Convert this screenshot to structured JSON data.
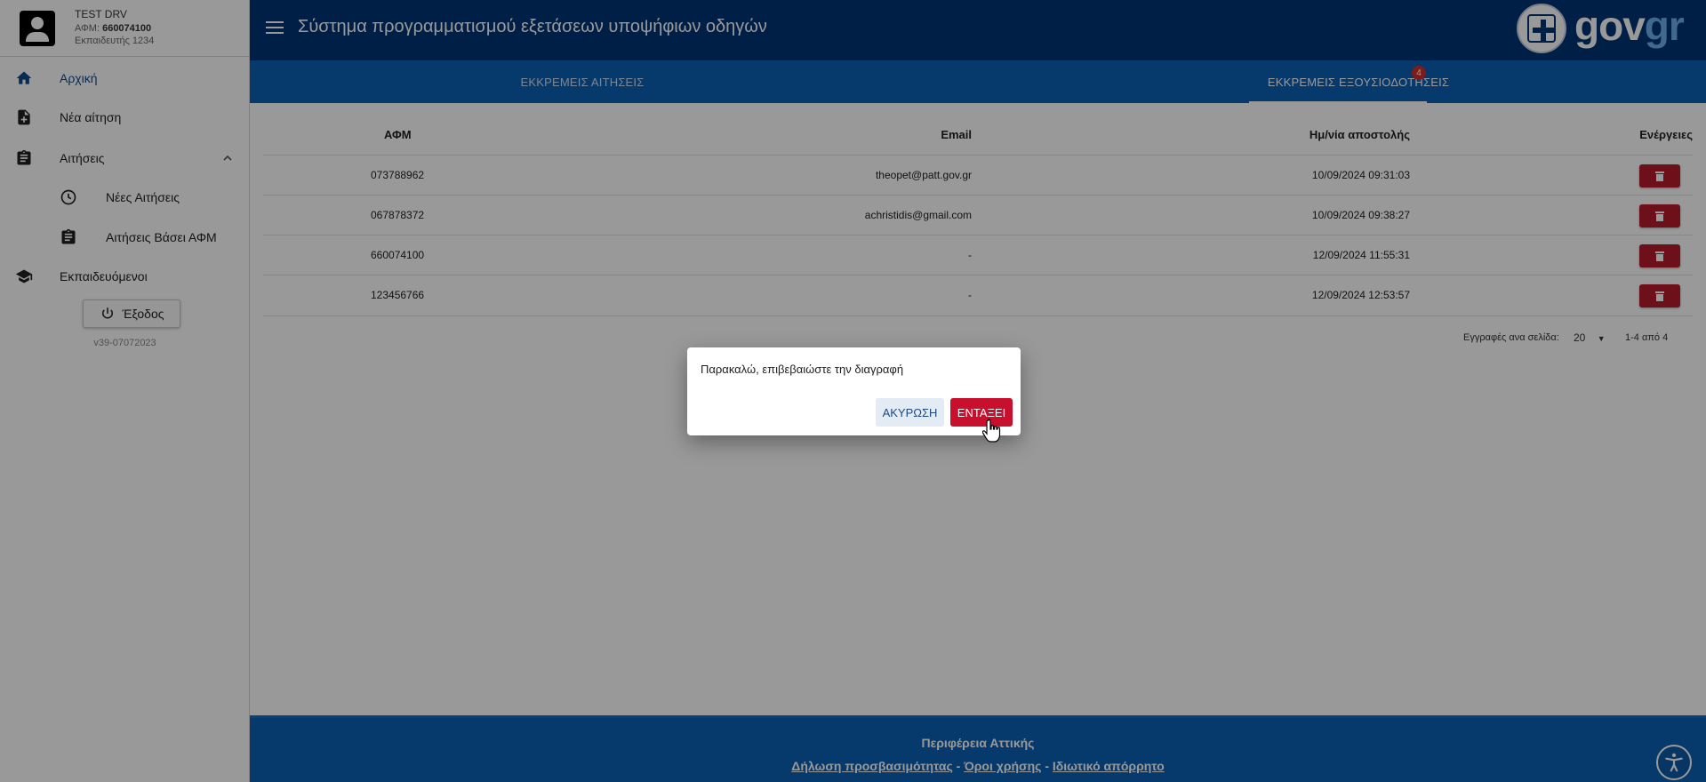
{
  "user": {
    "name": "TEST DRV",
    "afm_label": "ΑΦΜ:",
    "afm_value": "660074100",
    "instructor": "Εκπαιδευτής 1234"
  },
  "sidebar": {
    "items": [
      {
        "label": "Αρχική",
        "icon": "home-icon"
      },
      {
        "label": "Νέα αίτηση",
        "icon": "new-document-icon"
      },
      {
        "label": "Αιτήσεις",
        "icon": "clipboard-icon"
      },
      {
        "label": "Νέες Αιτήσεις",
        "icon": "clock-icon"
      },
      {
        "label": "Αιτήσεις Βάσει ΑΦΜ",
        "icon": "clipboard-icon"
      },
      {
        "label": "Εκπαιδευόμενοι",
        "icon": "graduation-cap-icon"
      }
    ],
    "logout_label": "Έξοδος",
    "version": "v39-07072023"
  },
  "header": {
    "title": "Σύστημα προγραμματισμού εξετάσεων υποψήφιων οδηγών",
    "logo_part1": "gov",
    "logo_part2": "gr"
  },
  "tabs": [
    {
      "label": "ΕΚΚΡΕΜΕΙΣ ΑΙΤΗΣΕΙΣ",
      "active": false
    },
    {
      "label": "ΕΚΚΡΕΜΕΙΣ ΕΞΟΥΣΙΟΔΟΤΗΣΕΙΣ",
      "active": true,
      "badge": "4"
    }
  ],
  "table": {
    "headers": [
      "ΑΦΜ",
      "Email",
      "Ημ/νία αποστολής",
      "Ενέργειες"
    ],
    "rows": [
      {
        "afm": "073788962",
        "email": "theopet@patt.gov.gr",
        "date": "10/09/2024 09:31:03"
      },
      {
        "afm": "067878372",
        "email": "achristidis@gmail.com",
        "date": "10/09/2024 09:38:27"
      },
      {
        "afm": "660074100",
        "email": "-",
        "date": "12/09/2024 11:55:31"
      },
      {
        "afm": "123456766",
        "email": "-",
        "date": "12/09/2024 12:53:57"
      }
    ],
    "rows_per_page_label": "Εγγραφές ανα σελίδα:",
    "rows_per_page_value": "20",
    "range": "1-4 από 4"
  },
  "dialog": {
    "message": "Παρακαλώ, επιβεβαιώστε την διαγραφή",
    "cancel_label": "ΑΚΥΡΩΣΗ",
    "ok_label": "ΕΝΤΑΞΕΙ"
  },
  "footer": {
    "title": "Περιφέρεια Αττικής",
    "link1": "Δήλωση προσβασιμότητας",
    "link2": "Όροι χρήσης",
    "link3": "Ιδιωτικό απόρρητο",
    "separator": " - "
  },
  "colors": {
    "header_bg": "#003476",
    "tab_bg": "#0a5fb4",
    "danger": "#c8102e",
    "badge": "#d32f2f"
  }
}
